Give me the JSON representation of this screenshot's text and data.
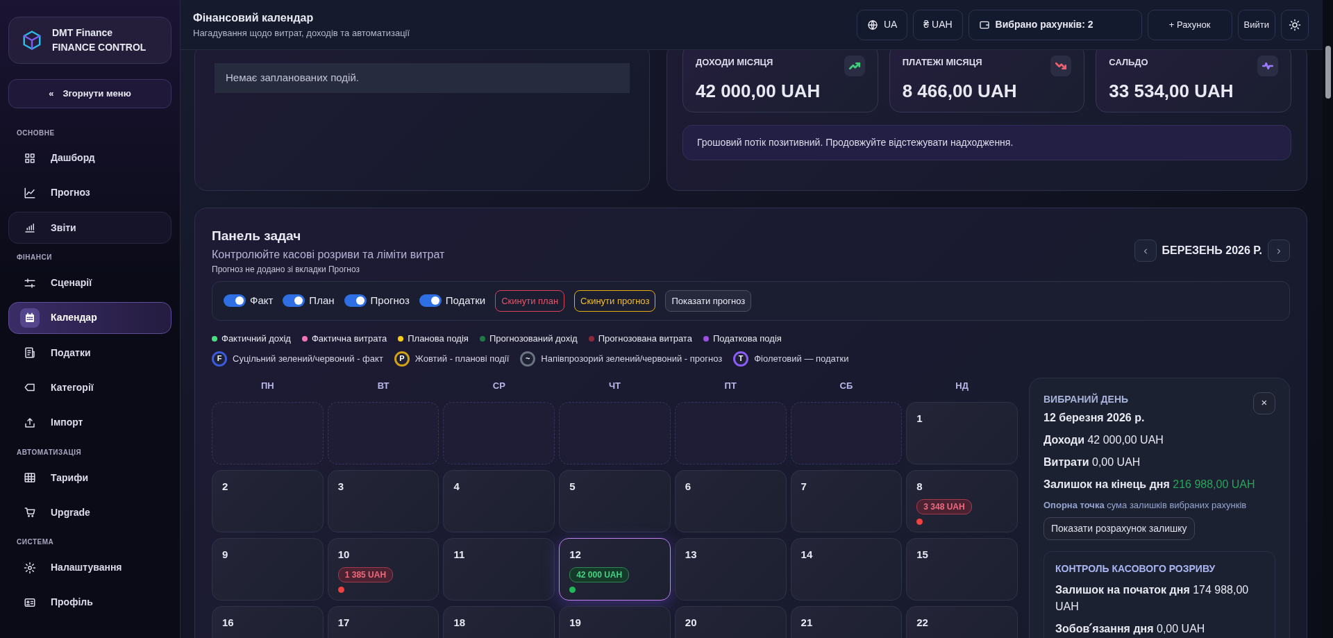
{
  "sidebar": {
    "brand": {
      "name": "DMT Finance",
      "subtitle": "FINANCE CONTROL"
    },
    "collapse": {
      "icon": "«",
      "label": "Згорнути меню"
    },
    "sections": [
      {
        "title": "ОСНОВНЕ",
        "items": [
          {
            "label": "Дашборд",
            "selected": false,
            "highlighted": false
          },
          {
            "label": "Прогноз",
            "selected": false,
            "highlighted": false
          },
          {
            "label": "Звіти",
            "selected": false,
            "highlighted": true
          }
        ]
      },
      {
        "title": "ФІНАНСИ",
        "items": [
          {
            "label": "Сценарії",
            "selected": false,
            "highlighted": false
          },
          {
            "label": "Календар",
            "selected": true,
            "highlighted": false
          },
          {
            "label": "Податки",
            "selected": false,
            "highlighted": false
          },
          {
            "label": "Категорії",
            "selected": false,
            "highlighted": false
          },
          {
            "label": "Імпорт",
            "selected": false,
            "highlighted": false
          }
        ]
      },
      {
        "title": "АВТОМАТИЗАЦІЯ",
        "items": [
          {
            "label": "Тарифи",
            "selected": false,
            "highlighted": false
          },
          {
            "label": "Upgrade",
            "selected": false,
            "highlighted": false
          }
        ]
      },
      {
        "title": "СИСТЕМА",
        "items": [
          {
            "label": "Налаштування",
            "selected": false,
            "highlighted": false
          },
          {
            "label": "Профіль",
            "selected": false,
            "highlighted": false
          }
        ]
      }
    ]
  },
  "header": {
    "title": "Фінансовий календар",
    "subtitle": "Нагадування щодо витрат, доходів та автоматизації",
    "language": "UA",
    "currency": "₴ UAH",
    "accounts": "Вибрано рахунків: 2",
    "add_account": "+ Рахунок",
    "logout": "Вийти"
  },
  "events_card": {
    "empty_text": "Немає запланованих подій."
  },
  "summary": {
    "stats": [
      {
        "label": "ДОХОДИ МІСЯЦЯ",
        "value": "42 000,00 UAH",
        "color": "#3ecf7a"
      },
      {
        "label": "ПЛАТЕЖІ МІСЯЦЯ",
        "value": "8 466,00 UAH",
        "color": "#f0606e"
      },
      {
        "label": "САЛЬДО",
        "value": "33 534,00 UAH",
        "color": "#9b7bff"
      }
    ],
    "note": "Грошовий потік позитивний. Продовжуйте відстежувати надходження."
  },
  "task_panel": {
    "title": "Панель задач",
    "subtitle": "Контролюйте касові розриви та ліміти витрат",
    "hint": "Прогноз не додано зі вкладки Прогноз",
    "month": "БЕРЕЗЕНЬ 2026 Р.",
    "toggles": [
      {
        "label": "Факт",
        "on": true
      },
      {
        "label": "План",
        "on": true
      },
      {
        "label": "Прогноз",
        "on": true
      },
      {
        "label": "Податки",
        "on": true
      }
    ],
    "actions": [
      {
        "label": "Скинути план",
        "kind": "danger"
      },
      {
        "label": "Скинути прогноз",
        "kind": "warning"
      },
      {
        "label": "Показати прогноз",
        "kind": "plain"
      }
    ],
    "legend": [
      {
        "label": "Фактичний дохід",
        "color": "#4ade80"
      },
      {
        "label": "Фактична витрата",
        "color": "#f472b6"
      },
      {
        "label": "Планова подія",
        "color": "#facc15"
      },
      {
        "label": "Прогнозований дохід",
        "color": "#1f7a45"
      },
      {
        "label": "Прогнозована витрата",
        "color": "#8a2a3a"
      },
      {
        "label": "Податкова подія",
        "color": "#9d4edd"
      }
    ],
    "keys": [
      {
        "letter": "F",
        "label": "Суцільний зелений/червоний - факт",
        "color": "#3b5bdb"
      },
      {
        "letter": "P",
        "label": "Жовтий - планові події",
        "color": "#d4a017"
      },
      {
        "letter": "~",
        "label": "Напівпрозорий зелений/червоний - прогноз",
        "color": "#6b7280"
      },
      {
        "letter": "T",
        "label": "Фіолетовий — податки",
        "color": "#8b5cf6"
      }
    ],
    "weekdays": [
      "ПН",
      "ВТ",
      "СР",
      "ЧТ",
      "ПТ",
      "СБ",
      "НД"
    ],
    "days": [
      {
        "kind": "blank"
      },
      {
        "kind": "blank"
      },
      {
        "kind": "blank"
      },
      {
        "kind": "blank"
      },
      {
        "kind": "blank"
      },
      {
        "kind": "blank"
      },
      {
        "kind": "day",
        "day": "1",
        "selected": false
      },
      {
        "kind": "day",
        "day": "2",
        "selected": false
      },
      {
        "kind": "day",
        "day": "3",
        "selected": false
      },
      {
        "kind": "day",
        "day": "4",
        "selected": false
      },
      {
        "kind": "day",
        "day": "5",
        "selected": false
      },
      {
        "kind": "day",
        "day": "6",
        "selected": false
      },
      {
        "kind": "day",
        "day": "7",
        "selected": false
      },
      {
        "kind": "day",
        "day": "8",
        "selected": false,
        "amount": "3 348 UAH",
        "income": false
      },
      {
        "kind": "day",
        "day": "9",
        "selected": false
      },
      {
        "kind": "day",
        "day": "10",
        "selected": false,
        "amount": "1 385 UAH",
        "income": false
      },
      {
        "kind": "day",
        "day": "11",
        "selected": false
      },
      {
        "kind": "day",
        "day": "12",
        "selected": true,
        "amount": "42 000 UAH",
        "income": true
      },
      {
        "kind": "day",
        "day": "13",
        "selected": false
      },
      {
        "kind": "day",
        "day": "14",
        "selected": false
      },
      {
        "kind": "day",
        "day": "15",
        "selected": false
      },
      {
        "kind": "day",
        "day": "16",
        "selected": false
      },
      {
        "kind": "day",
        "day": "17",
        "selected": false
      },
      {
        "kind": "day",
        "day": "18",
        "selected": false
      },
      {
        "kind": "day",
        "day": "19",
        "selected": false
      },
      {
        "kind": "day",
        "day": "20",
        "selected": false
      },
      {
        "kind": "day",
        "day": "21",
        "selected": false
      },
      {
        "kind": "day",
        "day": "22",
        "selected": false
      }
    ],
    "selected_day": {
      "heading": "ВИБРАНИЙ ДЕНЬ",
      "date": "12 березня 2026 р.",
      "close": "×",
      "lines": [
        {
          "label": "Доходи",
          "value": "42 000,00 UAH",
          "positive": false
        },
        {
          "label": "Витрати",
          "value": "0,00 UAH",
          "positive": false
        },
        {
          "label": "Залишок на кінець дня",
          "value": "216 988,00 UAH",
          "positive": true
        }
      ],
      "note": "**Опорна точка** сума залишків вибраних рахунків",
      "button": "Показати розрахунок залишку",
      "gap_control": {
        "title": "КОНТРОЛЬ КАСОВОГО РОЗРИВУ",
        "lines": [
          {
            "label": "Залишок на початок дня",
            "value": "174 988,00 UAH"
          },
          {
            "label": "Зобов՛язання дня",
            "value": "0,00 UAH"
          }
        ]
      }
    }
  }
}
